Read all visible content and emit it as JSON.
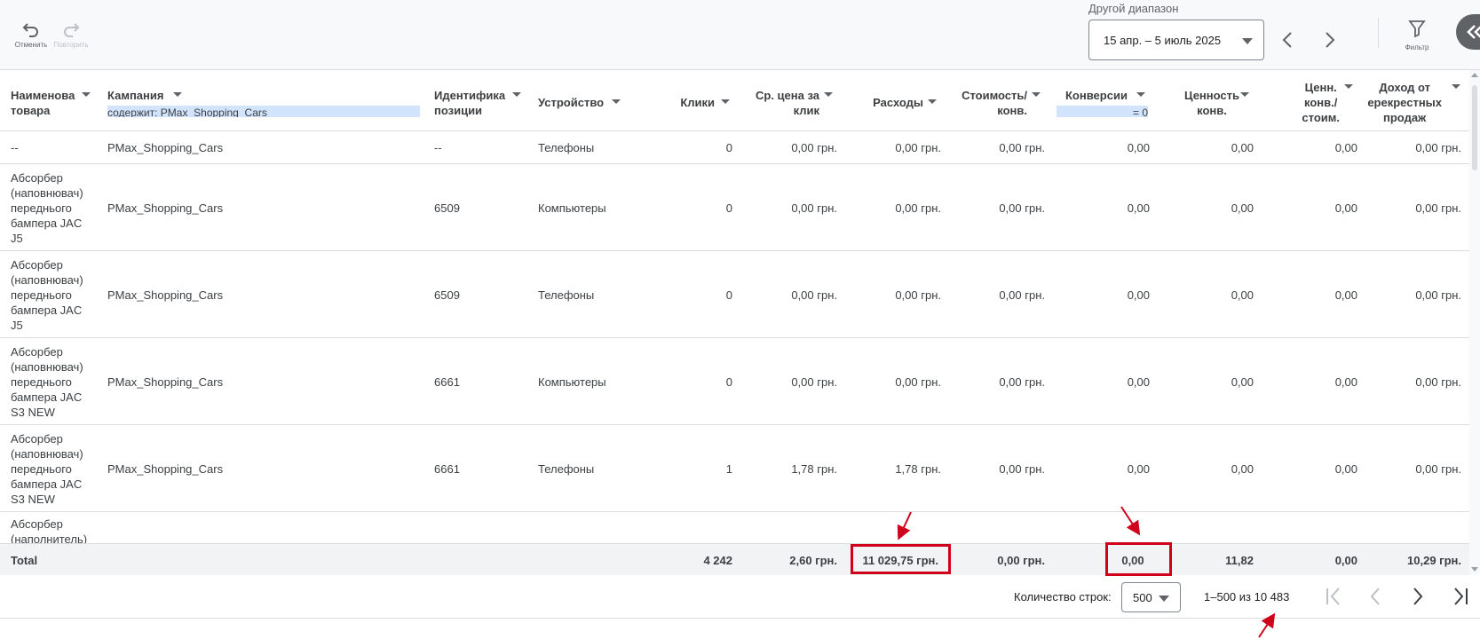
{
  "toolbar": {
    "undo_label": "Отменить",
    "redo_label": "Повторить",
    "date_range_label": "Другой диапазон",
    "date_range_value": "15 апр. – 5 июль 2025",
    "filter_label": "Фильтр"
  },
  "columns": {
    "product": "Наименова\nтовара",
    "campaign": "Кампания",
    "campaign_filter": "содержит: PMax_Shopping_Cars",
    "item_id": "Идентифика\nпозиции",
    "device": "Устройство",
    "clicks": "Клики",
    "avg_cpc": "Ср. цена за\nклик",
    "cost": "Расходы",
    "cost_conv": "Стоимость/\nконв.",
    "conversions": "Конверсии",
    "conversions_filter": "= 0",
    "conv_value": "Ценность\nконв.",
    "value_cost": "Ценн.\nконв./\nстоим.",
    "cross_sell": "Доход от\nерекрестных\nпродаж"
  },
  "rows": [
    {
      "product": "--",
      "campaign": "PMax_Shopping_Cars",
      "item_id": "--",
      "device": "Телефоны",
      "clicks": "0",
      "avg_cpc": "0,00 грн.",
      "cost": "0,00 грн.",
      "cost_conv": "0,00 грн.",
      "conversions": "0,00",
      "conv_value": "0,00",
      "value_cost": "0,00",
      "cross_sell": "0,00 грн."
    },
    {
      "product": "Абсорбер\n(наповнювач)\nпереднього\nбампера JAC\nJ5",
      "campaign": "PMax_Shopping_Cars",
      "item_id": "6509",
      "device": "Компьютеры",
      "clicks": "0",
      "avg_cpc": "0,00 грн.",
      "cost": "0,00 грн.",
      "cost_conv": "0,00 грн.",
      "conversions": "0,00",
      "conv_value": "0,00",
      "value_cost": "0,00",
      "cross_sell": "0,00 грн."
    },
    {
      "product": "Абсорбер\n(наповнювач)\nпереднього\nбампера JAC\nJ5",
      "campaign": "PMax_Shopping_Cars",
      "item_id": "6509",
      "device": "Телефоны",
      "clicks": "0",
      "avg_cpc": "0,00 грн.",
      "cost": "0,00 грн.",
      "cost_conv": "0,00 грн.",
      "conversions": "0,00",
      "conv_value": "0,00",
      "value_cost": "0,00",
      "cross_sell": "0,00 грн."
    },
    {
      "product": "Абсорбер\n(наповнювач)\nпереднього\nбампера JAC\nS3 NEW",
      "campaign": "PMax_Shopping_Cars",
      "item_id": "6661",
      "device": "Компьютеры",
      "clicks": "0",
      "avg_cpc": "0,00 грн.",
      "cost": "0,00 грн.",
      "cost_conv": "0,00 грн.",
      "conversions": "0,00",
      "conv_value": "0,00",
      "value_cost": "0,00",
      "cross_sell": "0,00 грн."
    },
    {
      "product": "Абсорбер\n(наповнювач)\nпереднього\nбампера JAC\nS3 NEW",
      "campaign": "PMax_Shopping_Cars",
      "item_id": "6661",
      "device": "Телефоны",
      "clicks": "1",
      "avg_cpc": "1,78 грн.",
      "cost": "1,78 грн.",
      "cost_conv": "0,00 грн.",
      "conversions": "0,00",
      "conv_value": "0,00",
      "value_cost": "0,00",
      "cross_sell": "0,00 грн."
    },
    {
      "product": "Абсорбер\n(наполнитель)",
      "campaign": "",
      "item_id": "",
      "device": "",
      "clicks": "",
      "avg_cpc": "",
      "cost": "",
      "cost_conv": "",
      "conversions": "",
      "conv_value": "",
      "value_cost": "",
      "cross_sell": ""
    }
  ],
  "total": {
    "label": "Total",
    "clicks": "4 242",
    "avg_cpc": "2,60 грн.",
    "cost": "11 029,75 грн.",
    "cost_conv": "0,00 грн.",
    "conversions": "0,00",
    "conv_value": "11,82",
    "value_cost": "0,00",
    "cross_sell": "10,29 грн."
  },
  "pagination": {
    "rows_label": "Количество строк:",
    "rows_value": "500",
    "range": "1–500 из 10 483"
  },
  "colors": {
    "highlight": "#d0021b",
    "filter_chip": "#d2e3fc"
  }
}
